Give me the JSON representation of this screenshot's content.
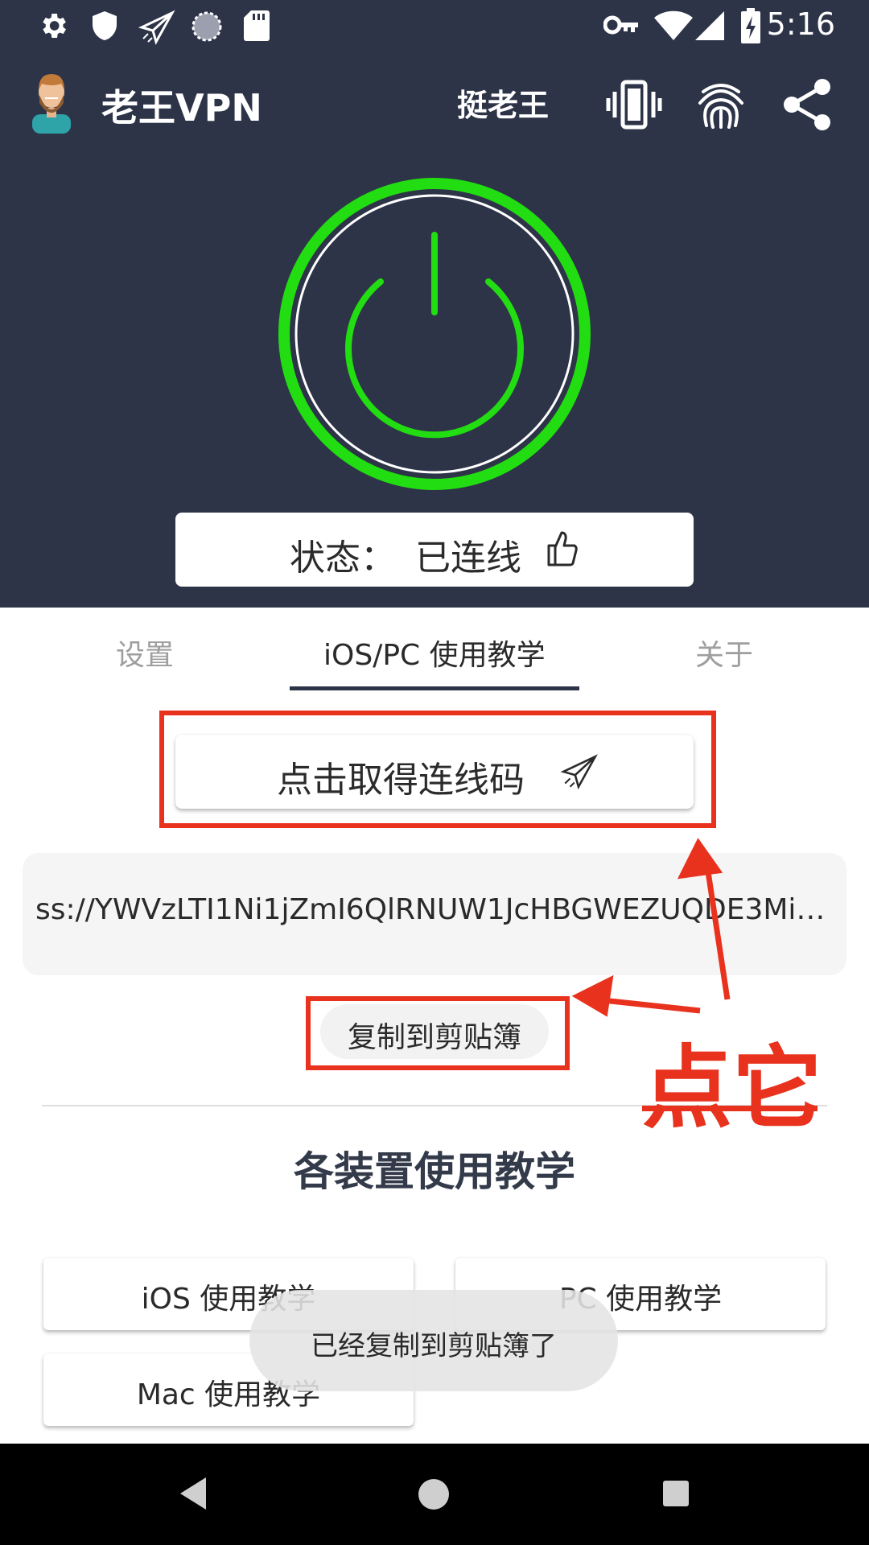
{
  "status_bar": {
    "time": "5:16",
    "left_icons": [
      "gear-icon",
      "shield-icon",
      "paper-plane-icon",
      "loading-circle-icon",
      "sd-card-icon"
    ],
    "right_icons": [
      "vpn-key-icon",
      "wifi-icon",
      "signal-icon",
      "battery-charging-icon"
    ]
  },
  "app_bar": {
    "title": "老王VPN",
    "action_text": "挺老王",
    "actions": [
      "vibrate-icon",
      "fingerprint-icon",
      "share-icon"
    ]
  },
  "hero": {
    "status_label": "状态：",
    "status_value": "已连线",
    "accent_color": "#22dd11",
    "background_color": "#2d3448"
  },
  "tabs": [
    {
      "label": "设置",
      "active": false
    },
    {
      "label": "iOS/PC 使用教学",
      "active": true
    },
    {
      "label": "关于",
      "active": false
    }
  ],
  "get_code_button": "点击取得连线码",
  "connection_code": "ss://YWVzLTI1Ni1jZmI6QlRNUW1JcHBGWEZUQDE3Mi4...",
  "copy_button": "复制到剪贴簿",
  "section_title": "各装置使用教学",
  "tutorials": {
    "ios": "iOS 使用教学",
    "pc": "PC 使用教学",
    "mac": "Mac 使用教学"
  },
  "toast": "已经复制到剪贴簿了",
  "annotation": {
    "text": "点它",
    "color": "#e8321e"
  }
}
